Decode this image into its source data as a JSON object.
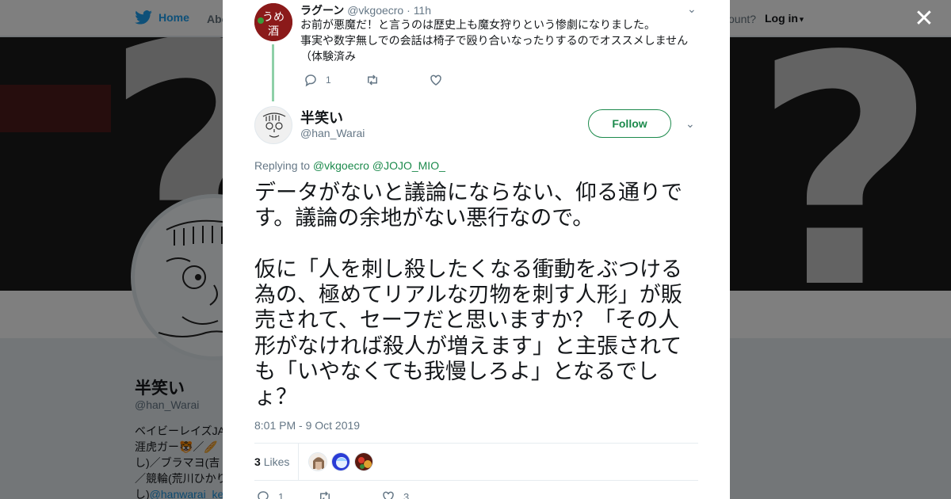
{
  "nav": {
    "home_label": "Home",
    "about_label": "Abo",
    "account_prompt": "ccount?",
    "login_label": "Log in"
  },
  "profile": {
    "name": "半笑い",
    "handle": "@han_Warai",
    "bio_lines": [
      "ベイビーレイズJA",
      "涯虎ガー🐯／🥖",
      "し)／ブラマヨ(吉",
      "／競輪(荒川ひかり",
      "し)"
    ],
    "bio_link": "@hanwarai_ke"
  },
  "parent_tweet": {
    "name": "ラグーン",
    "handle": "@vkgoecro",
    "separator": "·",
    "time": "11h",
    "text_lines": [
      "お前が悪魔だ！と言うのは歴史上も魔女狩りという惨劇になりました。",
      "事実や数字無しでの会話は椅子で殴り合いなったりするのでオススメしません",
      "（体験済み"
    ],
    "reply_count": "1",
    "retweet_count": "",
    "like_count": ""
  },
  "tweet": {
    "author_name": "半笑い",
    "author_handle": "@han_Warai",
    "follow_label": "Follow",
    "replying_prefix": "Replying to",
    "mention_1": "@vkgoecro",
    "mention_2": "@JOJO_MIO_",
    "body": "データがないと議論にならない、仰る通りです。議論の余地がない悪行なので。\n\n仮に「人を刺し殺したくなる衝動をぶつける為の、極めてリアルな刃物を刺す人形」が販売されて、セーフだと思いますか？「その人形がなければ殺人が増えます」と主張されても「いやなくても我慢しろよ」となるでしょ？",
    "timestamp": "8:01 PM - 9 Oct 2019",
    "likes_count": "3",
    "likes_label": "Likes",
    "reply_count": "1",
    "retweet_count": "",
    "like_count": "3"
  },
  "colors": {
    "accent": "#1c8a4c",
    "twitter_blue": "#1da1f2",
    "muted": "#657786"
  }
}
